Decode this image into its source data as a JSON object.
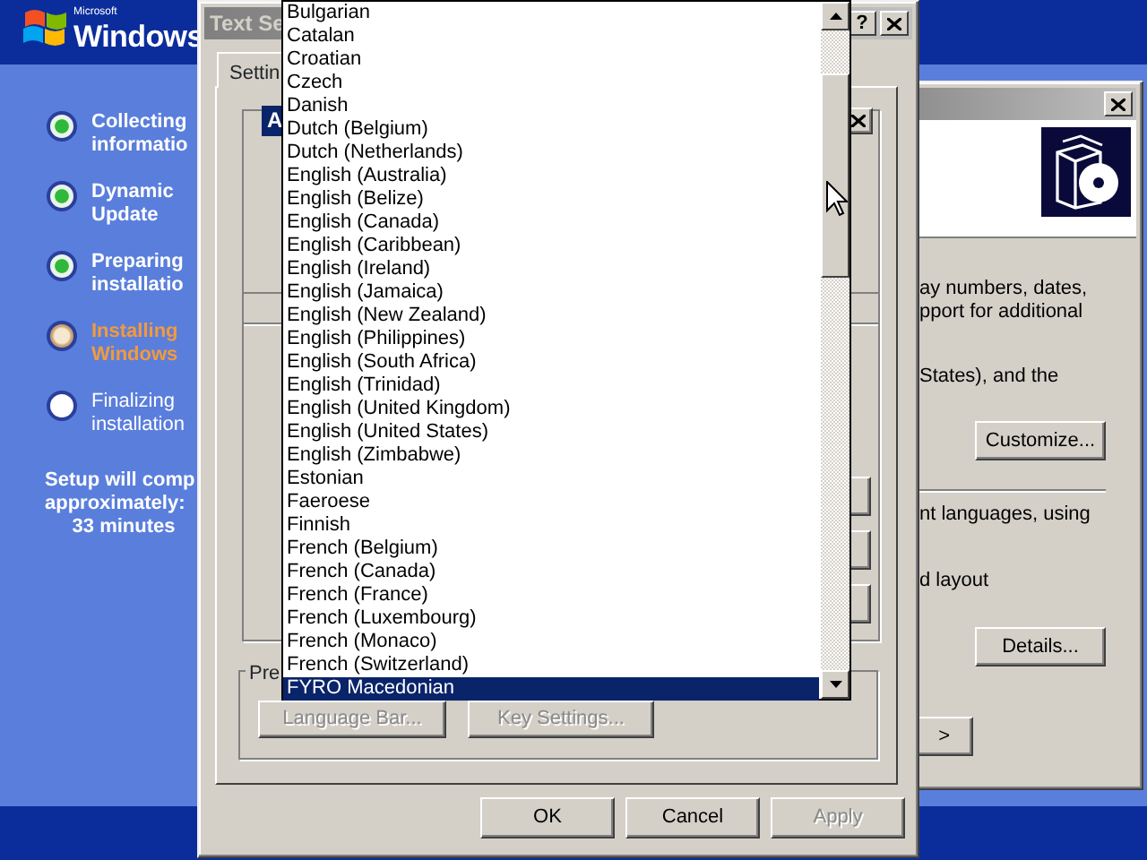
{
  "setup": {
    "logo": {
      "maker": "Microsoft",
      "product": "Windows"
    },
    "steps": [
      {
        "lines": [
          "Collecting",
          "informatio"
        ],
        "completed": true,
        "current": false
      },
      {
        "lines": [
          "Dynamic",
          "Update"
        ],
        "completed": true,
        "current": false
      },
      {
        "lines": [
          "Preparing",
          "installatio"
        ],
        "completed": true,
        "current": false
      },
      {
        "lines": [
          "Installing",
          "Windows"
        ],
        "completed": false,
        "current": true
      },
      {
        "lines": [
          "Finalizing",
          "installation"
        ],
        "completed": false,
        "current": false
      }
    ],
    "estimate": [
      "Setup will comp",
      "approximately:",
      "33 minutes"
    ]
  },
  "regional_dialog": {
    "texts": [
      "ay numbers, dates,",
      "pport for additional",
      "States), and the",
      "nt languages, using",
      "d layout"
    ],
    "buttons": [
      {
        "label": "Customize..."
      },
      {
        "label": "Details..."
      },
      {
        "label": ">"
      }
    ]
  },
  "text_services_dialog": {
    "title": "Text Se",
    "help": "?",
    "tab": {
      "label": "Settin",
      "selected": true
    },
    "heading": "A",
    "group_label": "Pre",
    "group_buttons": [
      {
        "label": "Language Bar...",
        "disabled": true
      },
      {
        "label": "Key Settings...",
        "disabled": true
      }
    ],
    "buttons": [
      {
        "label": "OK",
        "disabled": false
      },
      {
        "label": "Cancel",
        "disabled": false
      },
      {
        "label": "Apply",
        "disabled": true
      }
    ]
  },
  "language_dropdown": {
    "items": [
      {
        "label": "Bulgarian",
        "selected": false
      },
      {
        "label": "Catalan",
        "selected": false
      },
      {
        "label": "Croatian",
        "selected": false
      },
      {
        "label": "Czech",
        "selected": false
      },
      {
        "label": "Danish",
        "selected": false
      },
      {
        "label": "Dutch (Belgium)",
        "selected": false
      },
      {
        "label": "Dutch (Netherlands)",
        "selected": false
      },
      {
        "label": "English (Australia)",
        "selected": false
      },
      {
        "label": "English (Belize)",
        "selected": false
      },
      {
        "label": "English (Canada)",
        "selected": false
      },
      {
        "label": "English (Caribbean)",
        "selected": false
      },
      {
        "label": "English (Ireland)",
        "selected": false
      },
      {
        "label": "English (Jamaica)",
        "selected": false
      },
      {
        "label": "English (New Zealand)",
        "selected": false
      },
      {
        "label": "English (Philippines)",
        "selected": false
      },
      {
        "label": "English (South Africa)",
        "selected": false
      },
      {
        "label": "English (Trinidad)",
        "selected": false
      },
      {
        "label": "English (United Kingdom)",
        "selected": false
      },
      {
        "label": "English (United States)",
        "selected": false
      },
      {
        "label": "English (Zimbabwe)",
        "selected": false
      },
      {
        "label": "Estonian",
        "selected": false
      },
      {
        "label": "Faeroese",
        "selected": false
      },
      {
        "label": "Finnish",
        "selected": false
      },
      {
        "label": "French (Belgium)",
        "selected": false
      },
      {
        "label": "French (Canada)",
        "selected": false
      },
      {
        "label": "French (France)",
        "selected": false
      },
      {
        "label": "French (Luxembourg)",
        "selected": false
      },
      {
        "label": "French (Monaco)",
        "selected": false
      },
      {
        "label": "French (Switzerland)",
        "selected": false
      },
      {
        "label": "FYRO Macedonian",
        "selected": true
      }
    ]
  }
}
